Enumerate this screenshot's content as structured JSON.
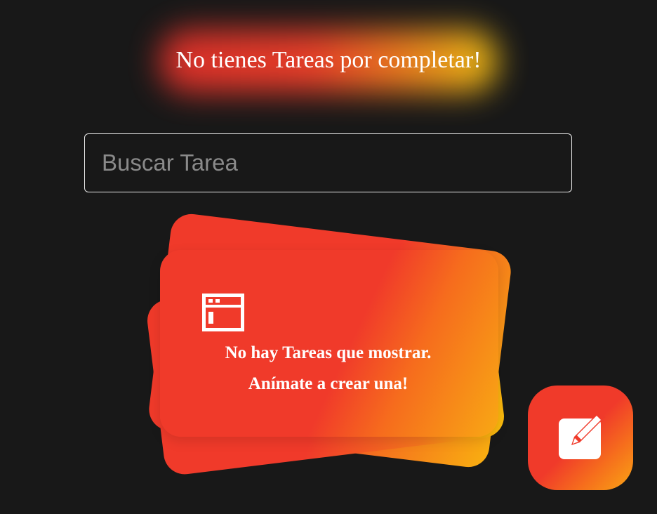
{
  "header": {
    "title": "No tienes Tareas por completar!"
  },
  "search": {
    "placeholder": "Buscar Tarea",
    "value": ""
  },
  "empty_state": {
    "icon": "browser-window-icon",
    "line1": "No hay Tareas que mostrar.",
    "line2": "Anímate a crear una!"
  },
  "fab": {
    "icon": "edit-square-icon"
  },
  "colors": {
    "background": "#181818",
    "accent_red": "#f03a2a",
    "accent_orange": "#f6701c",
    "accent_yellow": "#fbc10b"
  }
}
